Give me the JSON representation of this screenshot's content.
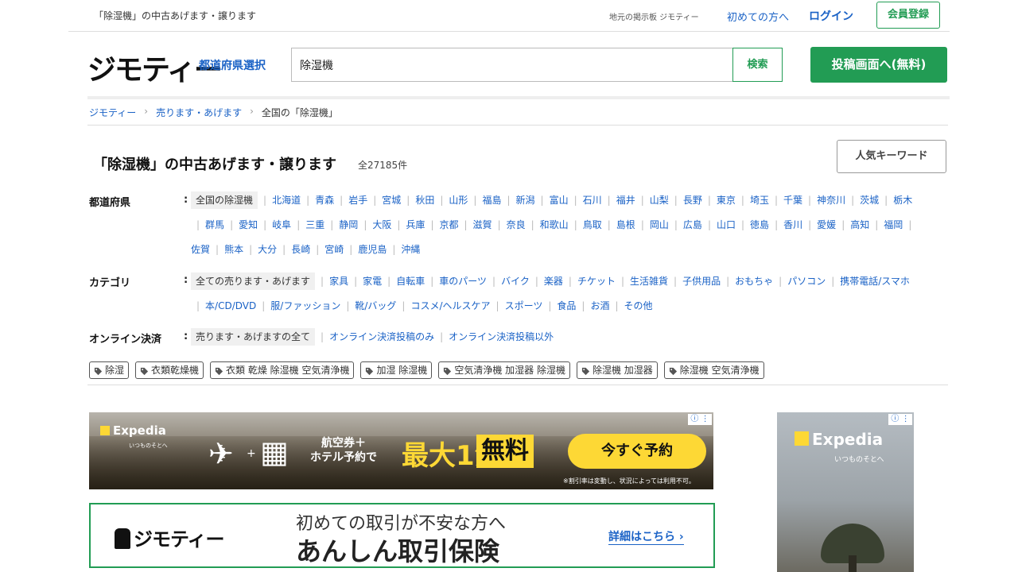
{
  "topbar": {
    "page_heading": "「除湿機」の中古あげます・譲ります",
    "board_label": "地元の掲示板 ジモティー",
    "first_time": "初めての方へ",
    "login": "ログイン",
    "register": "会員登録"
  },
  "header": {
    "logo": "ジモティー",
    "pref_select": "都道府県選択",
    "search_value": "除湿機",
    "search_button": "検索",
    "post_button": "投稿画面へ(無料)"
  },
  "breadcrumb": {
    "items": [
      "ジモティー",
      "売ります・あげます",
      "全国の「除湿機」"
    ]
  },
  "main": {
    "title": "「除湿機」の中古あげます・譲ります",
    "count": "全27185件",
    "keyword_button": "人気キーワード"
  },
  "filters": {
    "prefecture": {
      "label": "都道府県",
      "colon": ":",
      "items": [
        "全国の除湿機",
        "北海道",
        "青森",
        "岩手",
        "宮城",
        "秋田",
        "山形",
        "福島",
        "新潟",
        "富山",
        "石川",
        "福井",
        "山梨",
        "長野",
        "東京",
        "埼玉",
        "千葉",
        "神奈川",
        "茨城",
        "栃木",
        "群馬",
        "愛知",
        "岐阜",
        "三重",
        "静岡",
        "大阪",
        "兵庫",
        "京都",
        "滋賀",
        "奈良",
        "和歌山",
        "鳥取",
        "島根",
        "岡山",
        "広島",
        "山口",
        "徳島",
        "香川",
        "愛媛",
        "高知",
        "福岡",
        "佐賀",
        "熊本",
        "大分",
        "長崎",
        "宮崎",
        "鹿児島",
        "沖縄"
      ]
    },
    "category": {
      "label": "カテゴリ",
      "colon": ":",
      "items": [
        "全ての売ります・あげます",
        "家具",
        "家電",
        "自転車",
        "車のパーツ",
        "バイク",
        "楽器",
        "チケット",
        "生活雑貨",
        "子供用品",
        "おもちゃ",
        "パソコン",
        "携帯電話/スマホ",
        "本/CD/DVD",
        "服/ファッション",
        "靴/バッグ",
        "コスメ/ヘルスケア",
        "スポーツ",
        "食品",
        "お酒",
        "その他"
      ]
    },
    "payment": {
      "label": "オンライン決済",
      "colon": ":",
      "items": [
        "売ります・あげますの全て",
        "オンライン決済投稿のみ",
        "オンライン決済投稿以外"
      ]
    }
  },
  "tags": [
    "除湿",
    "衣類乾燥機",
    "衣類 乾燥 除湿機 空気清浄機",
    "加湿 除湿機",
    "空気清浄機 加湿器 除湿機",
    "除湿機 加湿器",
    "除湿機 空気清浄機"
  ],
  "ads": {
    "banner": {
      "brand": "Expedia",
      "brand_sub": "いつものそとへ",
      "text_line1": "航空券＋",
      "text_line2": "ホテル予約で",
      "big": "最大1泊",
      "free": "無料",
      "cta": "今すぐ予約",
      "note": "※割引率は変動し、状況によっては利用不可。"
    },
    "side": {
      "brand": "Expedia",
      "brand_sub": "いつものそとへ"
    },
    "insurance": {
      "logo": "ジモティー",
      "top": "初めての取引が不安な方へ",
      "main": "あんしん取引保険",
      "link": "詳細はこちら ›"
    }
  }
}
